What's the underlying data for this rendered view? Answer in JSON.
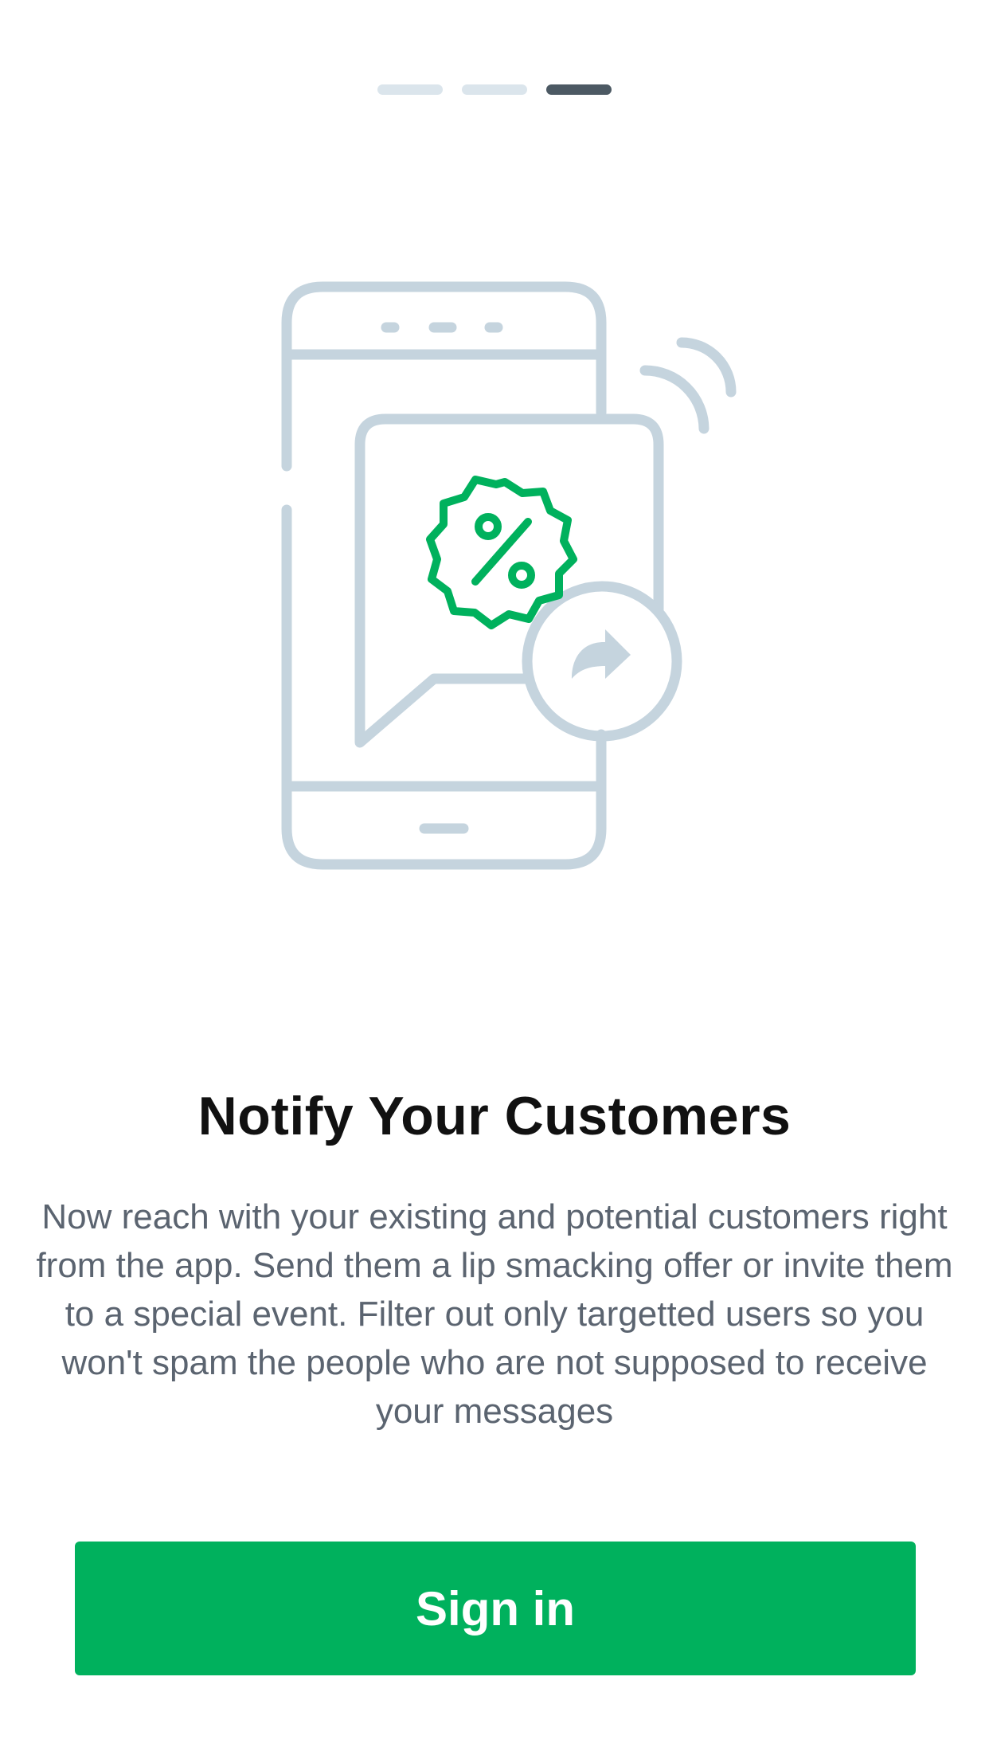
{
  "pager": {
    "pages": 3,
    "active_index": 2
  },
  "onboarding": {
    "illustration_icon": "phone-notification-discount-icon",
    "title": "Notify Your Customers",
    "description": "Now reach with your existing and potential customers right from the app. Send them a lip smacking offer or invite them to a special event. Filter out only targetted users so you won't spam the people who are not supposed to receive your messages"
  },
  "actions": {
    "signin_label": "Sign in"
  },
  "colors": {
    "accent": "#00b15d",
    "illustration_stroke": "#c5d4de",
    "pager_inactive": "#dbe5ec",
    "pager_active": "#4c5963",
    "title": "#111111",
    "body_text": "#5b6470"
  }
}
